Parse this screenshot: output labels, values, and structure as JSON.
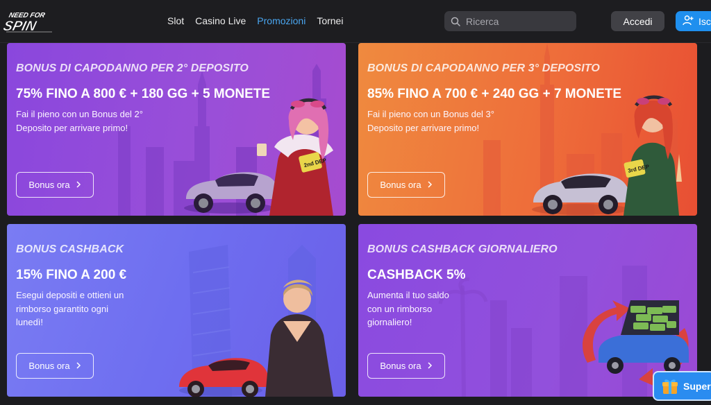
{
  "header": {
    "logo_text": "NEED FOR SPIN",
    "nav": [
      "Slot",
      "Casino Live",
      "Promozioni",
      "Tornei"
    ],
    "active_nav": "Promozioni",
    "search_placeholder": "Ricerca",
    "login_label": "Accedi",
    "signup_label": "Iscriviti"
  },
  "promos": [
    {
      "subtitle": "BONUS DI CAPODANNO PER 2° DEPOSITO",
      "headline": "75% FINO A 800 € + 180 GG + 5 MONETE",
      "desc_lines": [
        "Fai il pieno con un Bonus del 2°",
        "Deposito per arrivare primo!"
      ],
      "cta": "Bonus ora",
      "badge": "2nd DEP"
    },
    {
      "subtitle": "BONUS DI CAPODANNO PER 3° DEPOSITO",
      "headline": "85% FINO A 700 € + 240 GG + 7 MONETE",
      "desc_lines": [
        "Fai il pieno con un Bonus del 3°",
        "Deposito per arrivare primo!"
      ],
      "cta": "Bonus ora",
      "badge": "3rd DEP"
    },
    {
      "subtitle": "BONUS CASHBACK",
      "headline": "15% FINO A 200 €",
      "desc_lines": [
        "Esegui depositi e ottieni un",
        "rimborso garantito ogni",
        "lunedì!"
      ],
      "cta": "Bonus ora"
    },
    {
      "subtitle": "BONUS CASHBACK GIORNALIERO",
      "headline": "CASHBACK 5%",
      "desc_lines": [
        "Aumenta il tuo saldo",
        "con un rimborso",
        "giornaliero!"
      ],
      "cta": "Bonus ora"
    }
  ],
  "widget": {
    "label": "Super"
  },
  "colors": {
    "active_nav": "#4aa6f0",
    "signup": "#1f8fee",
    "card1": "#9a4fd8",
    "card2": "#ee6d3a",
    "card3": "#6e6ef0",
    "card4": "#9250dc"
  },
  "icons": [
    "search-icon",
    "user-plus-icon",
    "chevron-right-icon",
    "gift-icon"
  ]
}
